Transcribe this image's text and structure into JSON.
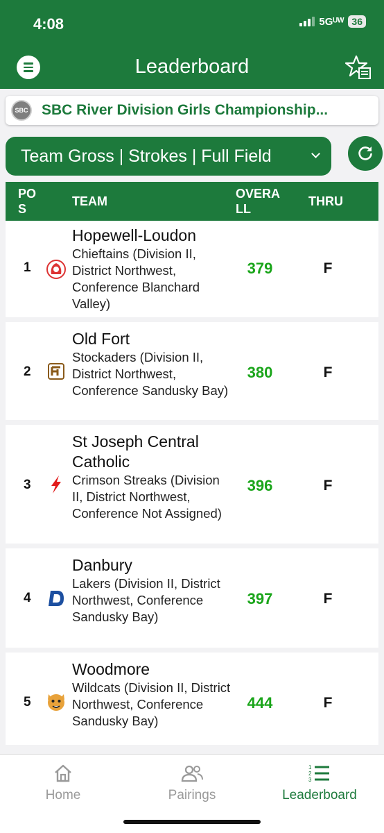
{
  "status": {
    "time": "4:08",
    "network": "5Gᵁᵂ",
    "battery": "36"
  },
  "header": {
    "title": "Leaderboard"
  },
  "event": {
    "name": "SBC River Division Girls Championship...",
    "logo_text": "SBC"
  },
  "filter": {
    "label": "Team Gross | Strokes | Full Field"
  },
  "table": {
    "headers": {
      "pos": "PO S",
      "team": "TEAM",
      "overall": "OVERA LL",
      "thru": "THRU"
    },
    "rows": [
      {
        "pos": "1",
        "name": "Hopewell-Loudon",
        "desc": "Chieftains (Division II, District Northwest, Conference Blanchard Valley)",
        "overall": "379",
        "thru": "F"
      },
      {
        "pos": "2",
        "name": "Old Fort",
        "desc": "Stockaders (Division II, District Northwest, Conference Sandusky Bay)",
        "overall": "380",
        "thru": "F"
      },
      {
        "pos": "3",
        "name": "St Joseph Central Catholic",
        "desc": "Crimson Streaks (Division II, District Northwest, Conference Not Assigned)",
        "overall": "396",
        "thru": "F"
      },
      {
        "pos": "4",
        "name": "Danbury",
        "desc": "Lakers (Division II, District Northwest, Conference Sandusky Bay)",
        "overall": "397",
        "thru": "F"
      },
      {
        "pos": "5",
        "name": "Woodmore",
        "desc": "Wildcats (Division II, District Northwest, Conference Sandusky Bay)",
        "overall": "444",
        "thru": "F"
      }
    ]
  },
  "tabs": [
    {
      "label": "Home",
      "icon": "home-icon"
    },
    {
      "label": "Pairings",
      "icon": "people-icon"
    },
    {
      "label": "Leaderboard",
      "icon": "ranked-list-icon",
      "active": true
    }
  ],
  "colors": {
    "brand_green": "#1d7a3c",
    "score_green": "#1aa51a"
  }
}
